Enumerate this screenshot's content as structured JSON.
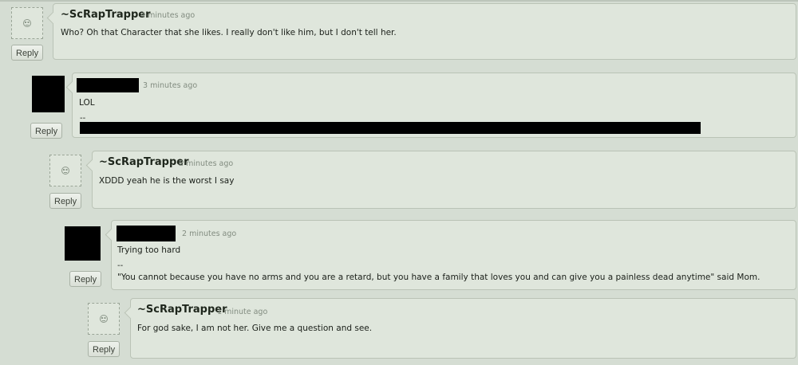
{
  "comments": [
    {
      "author": "~ScRapTrapper",
      "time": "4 minutes ago",
      "body": "Who? Oh that Character that she likes. I really don't like him, but I don't tell her.",
      "reply": "Reply"
    },
    {
      "author": "",
      "time": "3 minutes ago",
      "body": "LOL",
      "sig_sep": "--",
      "reply": "Reply"
    },
    {
      "author": "~ScRapTrapper",
      "time": "2 minutes ago",
      "body": "XDDD yeah he is the worst I say",
      "reply": "Reply"
    },
    {
      "author": "",
      "time": "2 minutes ago",
      "body": "Trying too hard",
      "sig_sep": "--",
      "signature": "\"You cannot because you have no arms and you are a retard, but you have a family that loves you and can give you a painless dead anytime\" said Mom.",
      "reply": "Reply"
    },
    {
      "author": "~ScRapTrapper",
      "time": "1 minute ago",
      "body": "For god sake, I am not her. Give me a question and see.",
      "reply": "Reply"
    }
  ],
  "icons": {
    "default_avatar": "smiley-face-icon"
  }
}
